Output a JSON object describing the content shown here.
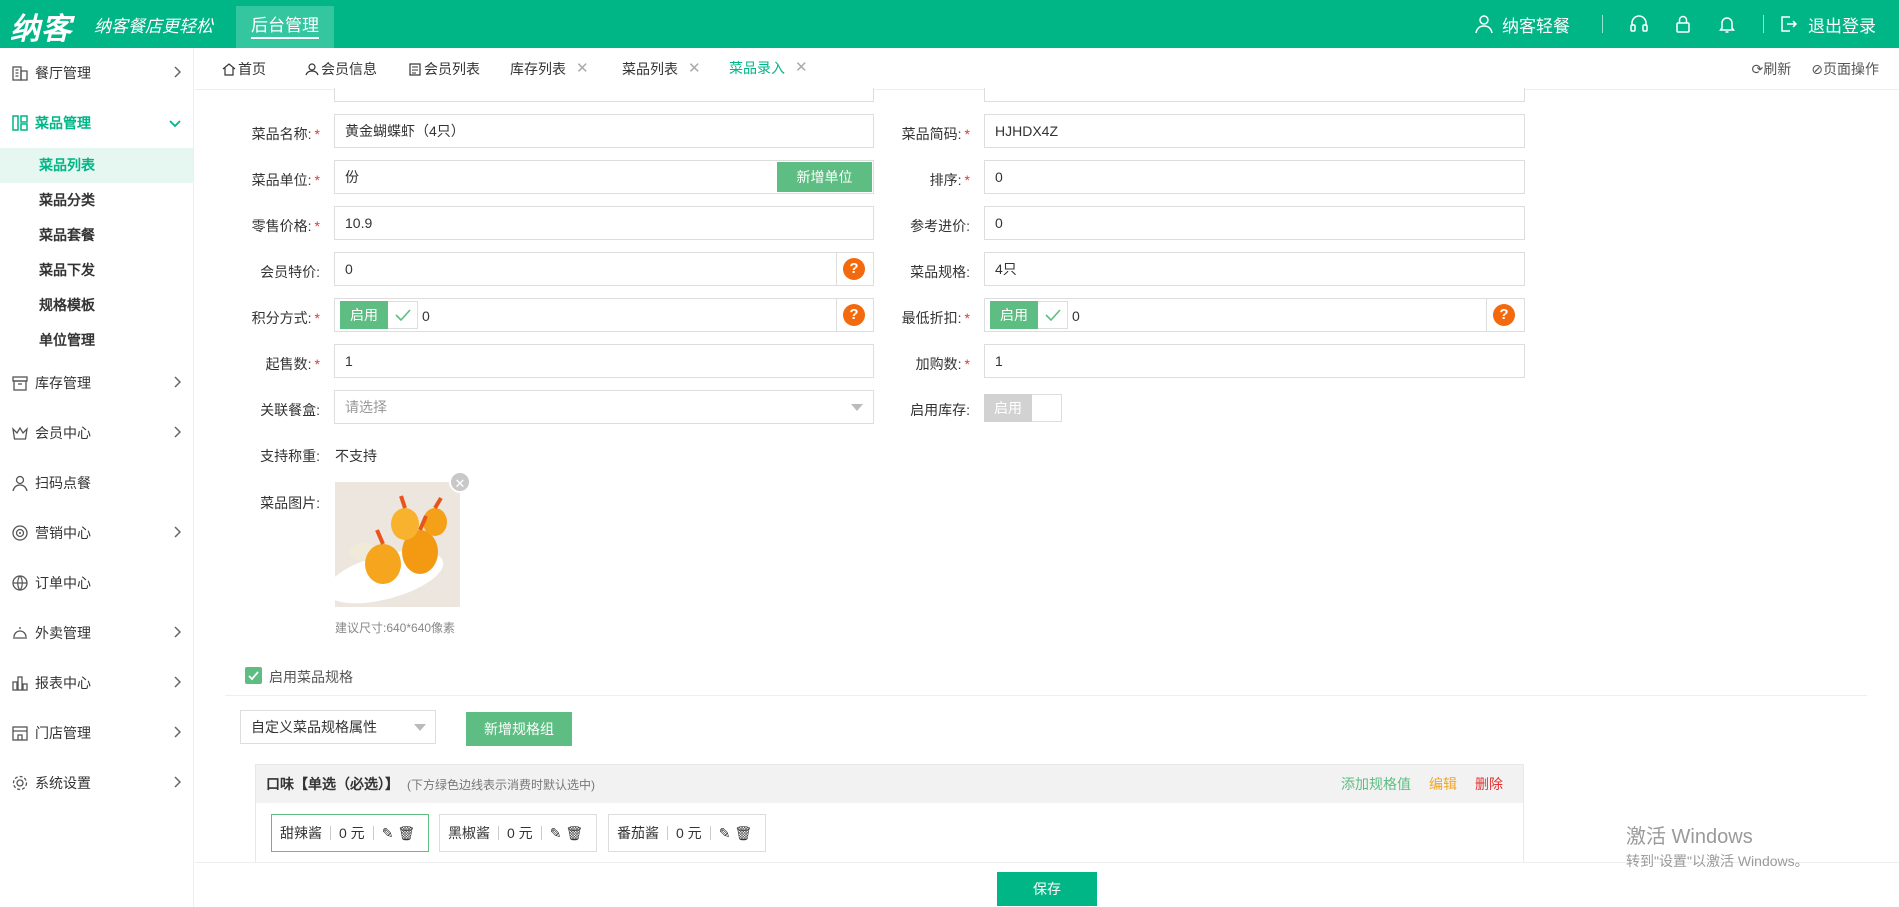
{
  "header": {
    "logo": "纳客",
    "slogan": "纳客餐店更轻松",
    "backend_label": "后台管理",
    "user_name": "纳客轻餐",
    "logout_label": "退出登录"
  },
  "sidebar": {
    "items": [
      {
        "label": "餐厅管理"
      },
      {
        "label": "菜品管理"
      },
      {
        "label": "库存管理"
      },
      {
        "label": "会员中心"
      },
      {
        "label": "扫码点餐"
      },
      {
        "label": "营销中心"
      },
      {
        "label": "订单中心"
      },
      {
        "label": "外卖管理"
      },
      {
        "label": "报表中心"
      },
      {
        "label": "门店管理"
      },
      {
        "label": "系统设置"
      }
    ],
    "sub_items": [
      "菜品列表",
      "菜品分类",
      "菜品套餐",
      "菜品下发",
      "规格模板",
      "单位管理"
    ]
  },
  "tabs": [
    {
      "label": "首页"
    },
    {
      "label": "会员信息"
    },
    {
      "label": "会员列表"
    },
    {
      "label": "库存列表"
    },
    {
      "label": "菜品列表"
    },
    {
      "label": "菜品录入"
    }
  ],
  "tab_actions": {
    "refresh": "刷新",
    "page_ops": "页面操作"
  },
  "form": {
    "name_label": "菜品名称:",
    "name_value": "黄金蝴蝶虾（4只）",
    "code_label": "菜品简码:",
    "code_value": "HJHDX4Z",
    "unit_label": "菜品单位:",
    "unit_value": "份",
    "add_unit": "新增单位",
    "sort_label": "排序:",
    "sort_value": "0",
    "price_label": "零售价格:",
    "price_value": "10.9",
    "ref_price_label": "参考进价:",
    "ref_price_value": "0",
    "member_price_label": "会员特价:",
    "member_price_value": "0",
    "spec_label": "菜品规格:",
    "spec_value": "4只",
    "points_label": "积分方式:",
    "points_toggle": "启用",
    "points_value": "0",
    "discount_label": "最低折扣:",
    "discount_toggle": "启用",
    "discount_value": "0",
    "min_sale_label": "起售数:",
    "min_sale_value": "1",
    "add_buy_label": "加购数:",
    "add_buy_value": "1",
    "box_label": "关联餐盒:",
    "box_placeholder": "请选择",
    "stock_label": "启用库存:",
    "stock_toggle": "启用",
    "weigh_label": "支持称重:",
    "weigh_value": "不支持",
    "image_label": "菜品图片:",
    "image_hint": "建议尺寸:640*640像素",
    "help": "?"
  },
  "spec": {
    "enable_label": "启用菜品规格",
    "select_value": "自定义菜品规格属性",
    "add_group": "新增规格组",
    "group_title": "口味【单选（必选）】",
    "group_note": "(下方绿色边线表示消费时默认选中)",
    "add_value": "添加规格值",
    "edit": "编辑",
    "delete": "删除",
    "chips": [
      {
        "name": "甜辣酱",
        "price": "0 元"
      },
      {
        "name": "黑椒酱",
        "price": "0 元"
      },
      {
        "name": "番茄酱",
        "price": "0 元"
      }
    ]
  },
  "save_label": "保存",
  "watermark": {
    "line1": "激活 Windows",
    "line2": "转到\"设置\"以激活 Windows。"
  },
  "colors": {
    "brand": "#00b586",
    "button": "#5ebd82",
    "help": "#f26a0d",
    "danger": "#e33333",
    "edit": "#f5a623"
  }
}
